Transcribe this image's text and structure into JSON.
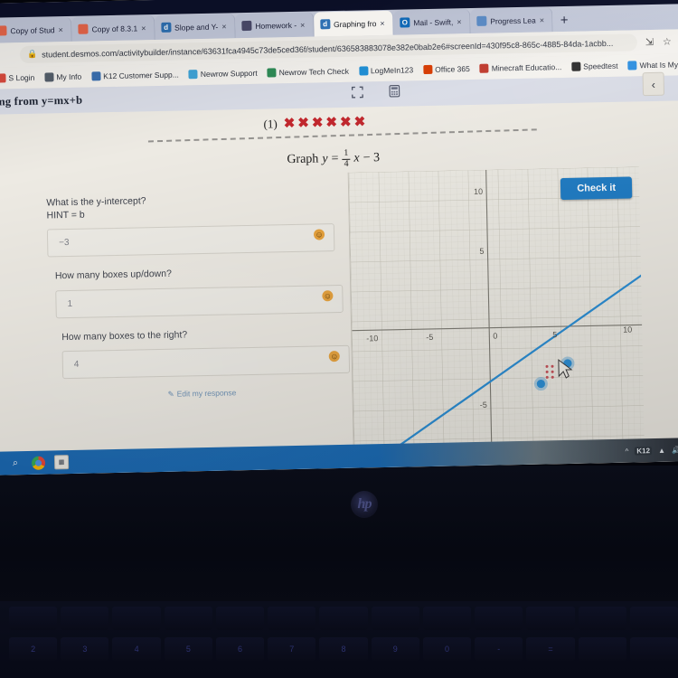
{
  "browser": {
    "tabs": [
      {
        "label": "Copy of Stud",
        "favicon": "doc-icon",
        "color": "#e8664a",
        "active": false
      },
      {
        "label": "Copy of 8.3.1",
        "favicon": "doc-icon",
        "color": "#e8664a",
        "active": false
      },
      {
        "label": "Slope and Y-",
        "favicon": "desmos-icon",
        "color": "#2d70b3",
        "active": false
      },
      {
        "label": "Homework -",
        "favicon": "image-icon",
        "color": "#4a4a6a",
        "active": false
      },
      {
        "label": "Graphing fro",
        "favicon": "desmos-icon",
        "color": "#2d70b3",
        "active": true
      },
      {
        "label": "Mail - Swift,",
        "favicon": "outlook-icon",
        "color": "#0f6cbd",
        "active": false
      },
      {
        "label": "Progress Lea",
        "favicon": "edit-icon",
        "color": "#5b8dc9",
        "active": false
      }
    ],
    "new_tab_label": "+",
    "close_label": "×",
    "url": "student.desmos.com/activitybuilder/instance/63631fca4945c73de5ced36f/student/636583883078e382e0bab2e6#screenId=430f95c8-865c-4885-84da-1acbb...",
    "lock_icon": "lock-icon",
    "share_icon": "share-icon",
    "star_icon": "star-icon",
    "bookmarks": [
      {
        "label": "S Login",
        "color": "#d94a3d"
      },
      {
        "label": "My Info",
        "color": "#555f6b"
      },
      {
        "label": "K12 Customer Supp...",
        "color": "#3a6fb0"
      },
      {
        "label": "Newrow Support",
        "color": "#3fa3d6"
      },
      {
        "label": "Newrow Tech Check",
        "color": "#2e8b57"
      },
      {
        "label": "LogMeIn123",
        "color": "#1f8fd6"
      },
      {
        "label": "Office 365",
        "color": "#d83b01"
      },
      {
        "label": "Minecraft Educatio...",
        "color": "#c0392b"
      },
      {
        "label": "Speedtest",
        "color": "#2b2b2b"
      },
      {
        "label": "What Is My B",
        "color": "#2d8fe0"
      }
    ]
  },
  "activity": {
    "title": "ing from y=mx+b",
    "fullscreen_icon": "expand-icon",
    "calculator_icon": "calculator-icon",
    "collapse_icon": "chevron-left-icon",
    "problem_number": "(1)",
    "x_marks": [
      "✖",
      "✖",
      "✖",
      "✖",
      "✖",
      "✖"
    ],
    "equation": {
      "prefix": "Graph",
      "variable_y": "y",
      "equals": "=",
      "numerator": "1",
      "denominator": "4",
      "variable_x": "x",
      "constant": "− 3"
    },
    "questions": [
      {
        "label": "What is the y-intercept?",
        "hint": "HINT = b",
        "value": "−3",
        "feedback_icon": "smiley-icon"
      },
      {
        "label": "How many boxes up/down?",
        "hint": "",
        "value": "1",
        "feedback_icon": "smiley-icon"
      },
      {
        "label": "How many boxes to the right?",
        "hint": "",
        "value": "4",
        "feedback_icon": "smiley-icon"
      }
    ],
    "edit_response": {
      "label": "Edit my response",
      "icon": "pencil-icon"
    },
    "check_button": "Check it"
  },
  "graph": {
    "x_ticks": [
      "-10",
      "-5",
      "0",
      "5",
      "10"
    ],
    "y_ticks": [
      "10",
      "5",
      "-5"
    ],
    "line_color": "#2d8fd5",
    "point_color": "#2d8fd5",
    "xmin": -11,
    "xmax": 11,
    "ymin": -11,
    "ymax": 11,
    "slope": 1.0,
    "intercept": -6.2,
    "points": [
      {
        "x": 2.2,
        "y": -4.0
      },
      {
        "x": 3.8,
        "y": -2.5
      }
    ],
    "cursor_icon": "arrow-cursor"
  },
  "taskbar": {
    "search_icon": "search-icon",
    "chrome_icon": "chrome-icon",
    "app_icon": "app-icon",
    "tray": {
      "chevron": "chevron-up-icon",
      "badge": "K12",
      "network_icon": "network-icon",
      "volume_icon": "volume-icon"
    }
  },
  "device": {
    "brand": "hp"
  }
}
